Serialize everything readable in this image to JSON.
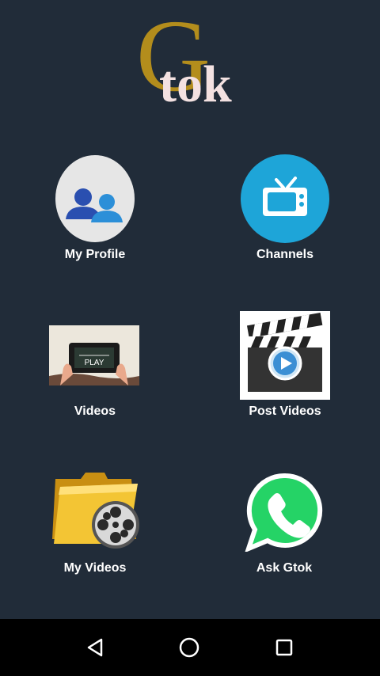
{
  "app": {
    "logo_letter": "G",
    "logo_word": "tok"
  },
  "menu": [
    {
      "label": "My Profile",
      "icon": "profile-icon"
    },
    {
      "label": "Channels",
      "icon": "tv-icon"
    },
    {
      "label": "Videos",
      "icon": "play-tablet-icon"
    },
    {
      "label": "Post Videos",
      "icon": "clapperboard-play-icon"
    },
    {
      "label": "My Videos",
      "icon": "video-folder-icon"
    },
    {
      "label": "Ask Gtok",
      "icon": "whatsapp-phone-icon"
    }
  ],
  "icon_labels": {
    "play_tablet": "PLAY"
  },
  "nav": {
    "back": "back-icon",
    "home": "home-icon",
    "recents": "recents-icon"
  },
  "colors": {
    "background": "#212c39",
    "logo_gold": "#b38d1c",
    "logo_pink": "#f3e1e1",
    "channels_blue": "#1ea5d8",
    "whatsapp_green": "#25d366"
  }
}
